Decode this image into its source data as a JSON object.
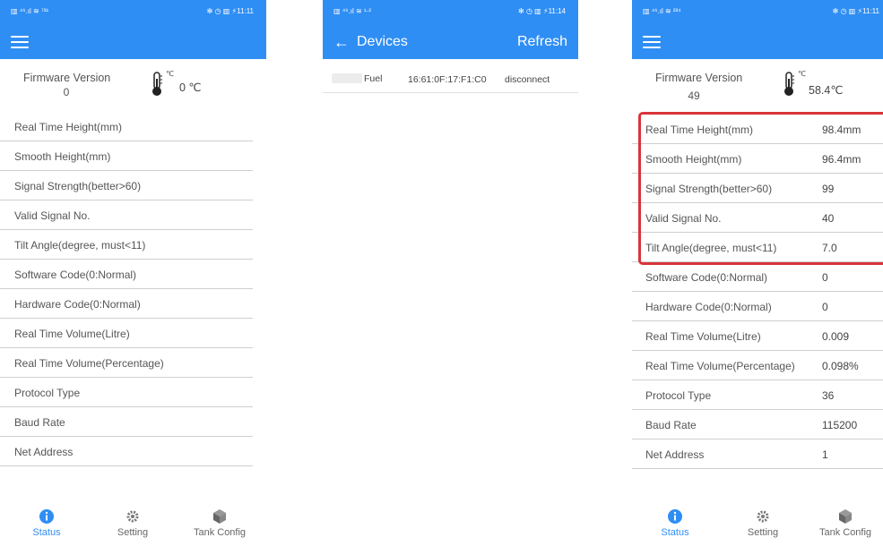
{
  "screen1": {
    "statusbar": {
      "left": "▥ ⁴⁶.ıl ≋ ⁷³¹",
      "right": "✻ ◷ ▥ ⚡11:11"
    },
    "firmware_label": "Firmware Version",
    "firmware_value": "0",
    "temperature": "0 ℃",
    "thermo_unit": "℃",
    "rows": [
      {
        "label": "Real Time Height(mm)",
        "value": ""
      },
      {
        "label": "Smooth Height(mm)",
        "value": ""
      },
      {
        "label": "Signal Strength(better>60)",
        "value": ""
      },
      {
        "label": "Valid Signal No.",
        "value": ""
      },
      {
        "label": "Tilt Angle(degree, must<11)",
        "value": ""
      },
      {
        "label": "Software Code(0:Normal)",
        "value": ""
      },
      {
        "label": "Hardware Code(0:Normal)",
        "value": ""
      },
      {
        "label": "Real Time Volume(Litre)",
        "value": ""
      },
      {
        "label": "Real Time Volume(Percentage)",
        "value": ""
      },
      {
        "label": "Protocol Type",
        "value": ""
      },
      {
        "label": "Baud Rate",
        "value": ""
      },
      {
        "label": "Net Address",
        "value": ""
      }
    ],
    "tabs": [
      "Status",
      "Setting",
      "Tank Config"
    ]
  },
  "screen2": {
    "statusbar": {
      "left": "▥ ⁴⁶.ıl ≋ ¹·²",
      "right": "✻ ◷ ▥ ⚡11:14"
    },
    "title": "Devices",
    "refresh": "Refresh",
    "device": {
      "name": "Fuel",
      "mac": "16:61:0F:17:F1:C0",
      "action": "disconnect"
    }
  },
  "screen3": {
    "statusbar": {
      "left": "▥ ⁴⁶.ıl ≋ ²³⁴",
      "right": "✻ ◷ ▥ ⚡11:11"
    },
    "firmware_label": "Firmware Version",
    "firmware_value": "49",
    "temperature": "58.4℃",
    "thermo_unit": "℃",
    "rows": [
      {
        "label": "Real Time Height(mm)",
        "value": "98.4mm"
      },
      {
        "label": "Smooth Height(mm)",
        "value": "96.4mm"
      },
      {
        "label": "Signal Strength(better>60)",
        "value": "99"
      },
      {
        "label": "Valid Signal No.",
        "value": "40"
      },
      {
        "label": "Tilt Angle(degree, must<11)",
        "value": "7.0"
      },
      {
        "label": "Software Code(0:Normal)",
        "value": "0"
      },
      {
        "label": "Hardware Code(0:Normal)",
        "value": "0"
      },
      {
        "label": "Real Time Volume(Litre)",
        "value": "0.009"
      },
      {
        "label": "Real Time Volume(Percentage)",
        "value": "0.098%"
      },
      {
        "label": "Protocol Type",
        "value": "36"
      },
      {
        "label": "Baud Rate",
        "value": "115200"
      },
      {
        "label": "Net Address",
        "value": "1"
      }
    ],
    "tabs": [
      "Status",
      "Setting",
      "Tank Config"
    ]
  },
  "colors": {
    "accent": "#2f8ef4",
    "highlight": "#d9343a"
  }
}
